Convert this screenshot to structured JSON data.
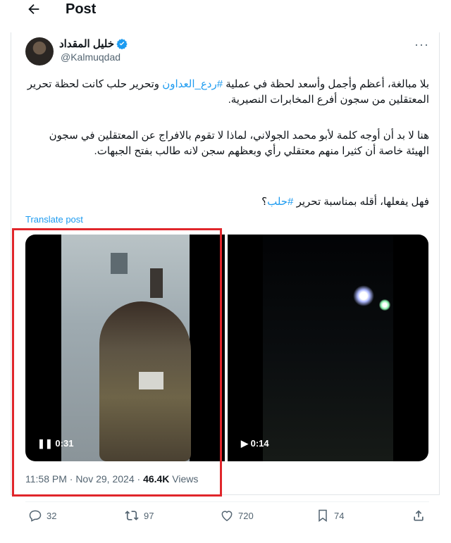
{
  "header": {
    "title": "Post"
  },
  "author": {
    "name": "خليل المقداد",
    "handle": "@Kalmuqdad"
  },
  "post": {
    "p1_a": "بلا مبالغة، أعظم وأجمل وأسعد لحظة في عملية ",
    "p1_hash": "#ردع_العداون",
    "p1_b": " وتحرير حلب كانت لحظة تحرير المعتقلين من سجون أفرع المخابرات النصيرية.",
    "p2": "هنا لا بد أن أوجه كلمة لأبو محمد الجولاني، لماذا لا تقوم بالافراج عن المعتقلين في سجون الهيئة خاصة أن كثيرا منهم معتقلي رأي وبعظهم سجن لانه طالب بفتح الجبهات.",
    "p3_a": "فهل يفعلها، أقله بمناسبة تحرير ",
    "p3_hash": "#حلب",
    "p3_b": "؟",
    "translate": "Translate post"
  },
  "media": [
    {
      "duration": "0:31",
      "state": "pause"
    },
    {
      "duration": "0:14",
      "state": "play"
    }
  ],
  "meta": {
    "time": "11:58 PM · Nov 29, 2024 · ",
    "views": "46.4K",
    "views_label": " Views"
  },
  "actions": {
    "replies": "32",
    "reposts": "97",
    "likes": "720",
    "bookmarks": "74"
  },
  "colors": {
    "accent": "#1d9bf0",
    "highlight": "#e0262b",
    "muted": "#536471"
  }
}
